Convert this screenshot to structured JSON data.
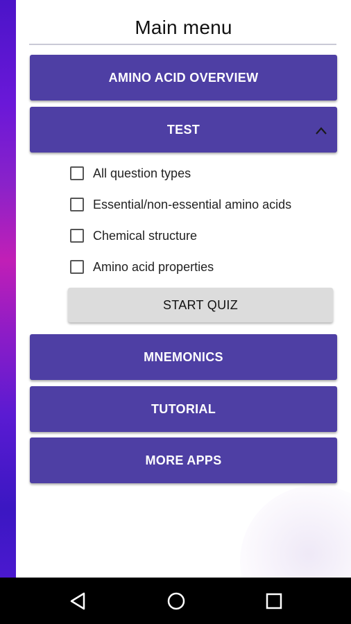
{
  "title": "Main menu",
  "menu": {
    "overview": "AMINO ACID OVERVIEW",
    "test": "TEST",
    "mnemonics": "MNEMONICS",
    "tutorial": "TUTORIAL",
    "more_apps": "MORE APPS"
  },
  "test_options": [
    {
      "label": "All question types",
      "checked": false
    },
    {
      "label": "Essential/non-essential amino acids",
      "checked": false
    },
    {
      "label": "Chemical structure",
      "checked": false
    },
    {
      "label": "Amino acid properties",
      "checked": false
    }
  ],
  "start_quiz": "START QUIZ",
  "colors": {
    "button": "#4e3fa4",
    "start_button": "#dcdcdc",
    "navbar": "#000000"
  },
  "icons": {
    "test_expand": "chevron-up-icon",
    "nav_back": "back-triangle-icon",
    "nav_home": "home-circle-icon",
    "nav_recents": "recents-square-icon"
  }
}
